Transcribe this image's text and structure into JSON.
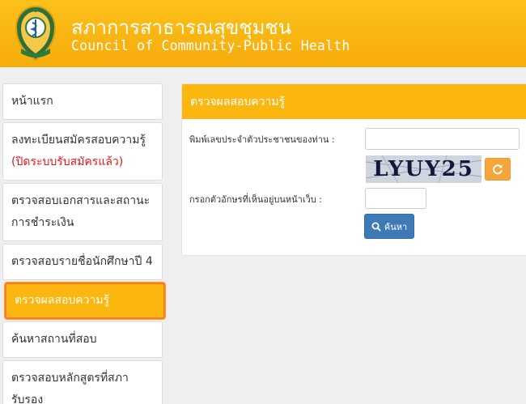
{
  "header": {
    "title_th": "สภาการสาธารณสุขชุมชน",
    "title_en": "Council of Community-Public Health",
    "logo_icon": "council-emblem-icon"
  },
  "sidebar": {
    "items": [
      {
        "label": "หน้าแรก",
        "note": ""
      },
      {
        "label": "ลงทะเบียนสมัครสอบความรู้",
        "note": "(ปิดระบบรับสมัครแล้ว)"
      },
      {
        "label": "ตรวจสอบเอกสารและสถานะ",
        "label2": "การชำระเงิน"
      },
      {
        "label": "ตรวจสอบรายชื่อนักศึกษาปี 4"
      },
      {
        "label": "ตรวจผลสอบความรู้",
        "active": true
      },
      {
        "label": "ค้นหาสถานที่สอบ"
      },
      {
        "label": "ตรวจสอบหลักสูตรที่สภา",
        "label2": "รับรอง"
      }
    ]
  },
  "panel": {
    "heading": "ตรวจผลสอบความรู้",
    "id_label": "พิมพ์เลขประจำตัวประชาชนของท่าน :",
    "id_value": "",
    "captcha_text": "LYUY25",
    "captcha_label": "กรอกตัวอักษรที่เห็นอยู่บนหน้าเว็บ :",
    "captcha_value": "",
    "search_label": "ค้นหา"
  },
  "colors": {
    "header": "#f8b410",
    "active_item": "#fbb70f",
    "active_border": "#ff7a1f",
    "note_red": "#e8171c",
    "search_button": "#3d7ab6",
    "refresh_button": "#f6a53a"
  }
}
